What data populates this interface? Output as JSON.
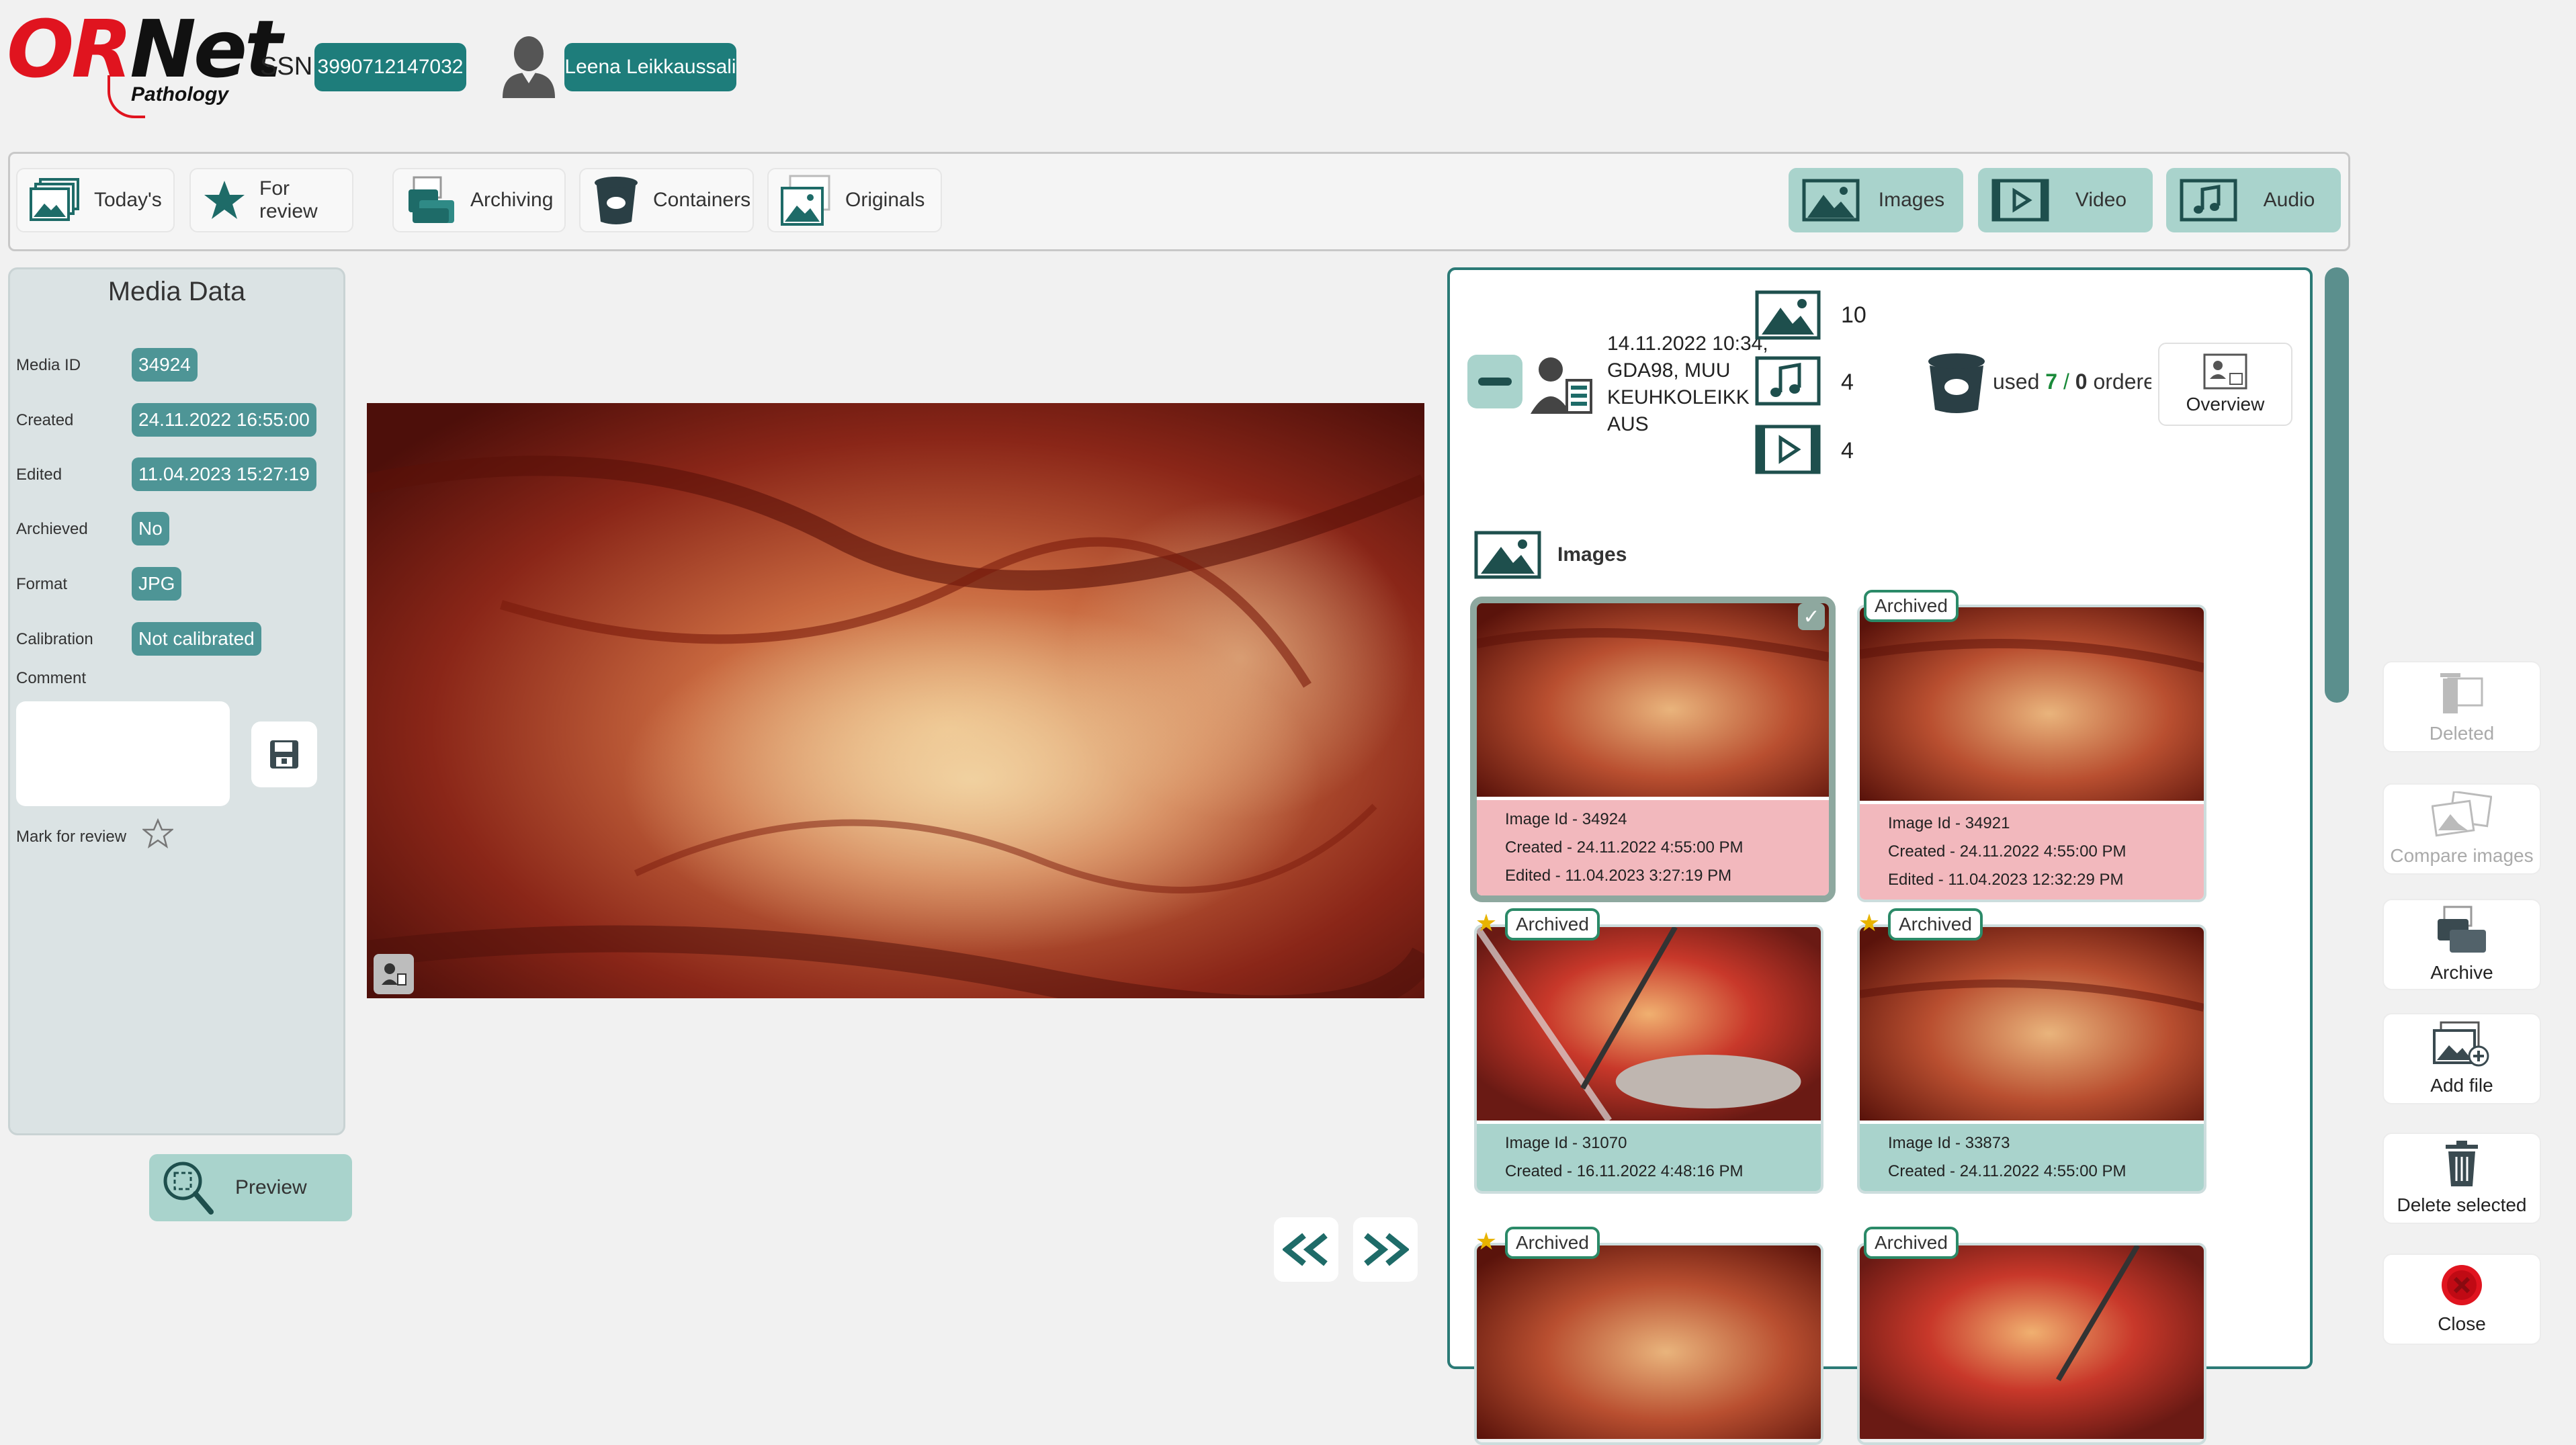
{
  "header": {
    "logo_text_or": "OR",
    "logo_text_net": "Net",
    "logo_sub": "Pathology",
    "ssn_label": "SSN",
    "ssn_value": "3990712147032",
    "user_name": "Leena Leikkaussali"
  },
  "toolbar": {
    "left": [
      {
        "label": "Today's",
        "icon": "gallery-icon"
      },
      {
        "label": "For review",
        "icon": "star-icon"
      },
      {
        "label": "Archiving",
        "icon": "archive-icon"
      },
      {
        "label": "Containers",
        "icon": "container-icon"
      },
      {
        "label": "Originals",
        "icon": "originals-icon"
      }
    ],
    "right": [
      {
        "label": "Images",
        "icon": "image-icon"
      },
      {
        "label": "Video",
        "icon": "video-icon"
      },
      {
        "label": "Audio",
        "icon": "audio-icon"
      }
    ]
  },
  "media_data": {
    "title": "Media Data",
    "fields": [
      {
        "label": "Media ID",
        "value": "34924"
      },
      {
        "label": "Created",
        "value": "24.11.2022 16:55:00"
      },
      {
        "label": "Edited",
        "value": "11.04.2023 15:27:19"
      },
      {
        "label": "Archieved",
        "value": "No"
      },
      {
        "label": "Format",
        "value": "JPG"
      },
      {
        "label": "Calibration",
        "value": "Not calibrated"
      }
    ],
    "comment_label": "Comment",
    "comment_value": "",
    "mark_for_review_label": "Mark for review",
    "preview_label": "Preview"
  },
  "case": {
    "info_text": "14.11.2022 10:34, GDA98, MUU KEUHKOLEIKK AUS",
    "image_count": "10",
    "audio_count": "4",
    "video_count": "4",
    "used_label": "used",
    "used_value": "7",
    "ordered_value": "0",
    "ordered_label": "ordere",
    "overview_label": "Overview",
    "images_section_label": "Images"
  },
  "gallery": [
    {
      "badge": "",
      "starred": false,
      "selected": true,
      "state": "pink",
      "lines": [
        "Image Id - 34924",
        "Created - 24.11.2022 4:55:00 PM",
        "Edited - 11.04.2023 3:27:19 PM"
      ]
    },
    {
      "badge": "Archived",
      "starred": false,
      "selected": false,
      "state": "pink",
      "lines": [
        "Image Id - 34921",
        "Created - 24.11.2022 4:55:00 PM",
        "Edited - 11.04.2023 12:32:29 PM"
      ]
    },
    {
      "badge": "Archived",
      "starred": true,
      "selected": false,
      "state": "green",
      "lines": [
        "Image Id - 31070",
        "Created - 16.11.2022 4:48:16 PM"
      ]
    },
    {
      "badge": "Archived",
      "starred": true,
      "selected": false,
      "state": "green",
      "lines": [
        "Image Id - 33873",
        "Created - 24.11.2022 4:55:00 PM"
      ]
    },
    {
      "badge": "Archived",
      "starred": true,
      "selected": false,
      "state": "green",
      "lines": []
    },
    {
      "badge": "Archived",
      "starred": false,
      "selected": false,
      "state": "green",
      "lines": []
    }
  ],
  "side_actions": {
    "deleted": "Deleted",
    "compare": "Compare images",
    "archive": "Archive",
    "add_file": "Add file",
    "delete_selected": "Delete selected",
    "close": "Close"
  },
  "colors": {
    "teal": "#1e7d7b",
    "teal_light": "#a9d3cc",
    "pink": "#f2b8bd",
    "panel_border": "#2b7a76",
    "close_red": "#e0141f"
  }
}
